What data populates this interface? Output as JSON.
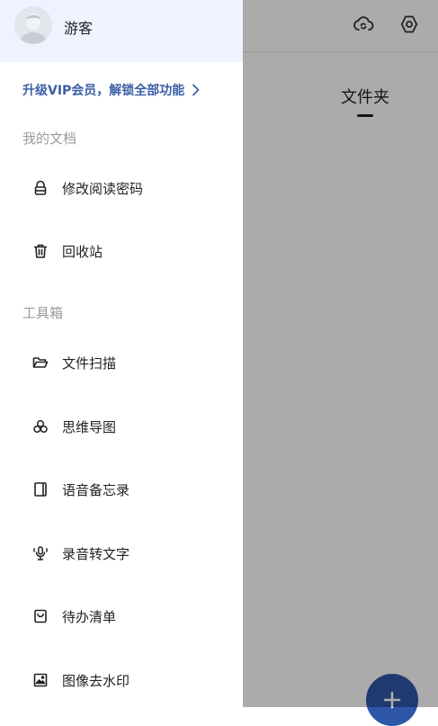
{
  "app": {
    "tab_label": "文件夹"
  },
  "drawer": {
    "username": "游客",
    "vip_text": "升级VIP会员，解锁全部功能",
    "sections": [
      {
        "title": "我的文档"
      },
      {
        "title": "工具箱"
      }
    ],
    "items": [
      {
        "label": "修改阅读密码",
        "icon": "lock-icon"
      },
      {
        "label": "回收站",
        "icon": "trash-icon"
      },
      {
        "label": "文件扫描",
        "icon": "folder-icon"
      },
      {
        "label": "思维导图",
        "icon": "mindmap-icon"
      },
      {
        "label": "语音备忘录",
        "icon": "note-icon"
      },
      {
        "label": "录音转文字",
        "icon": "microphone-icon"
      },
      {
        "label": "待办清单",
        "icon": "todo-icon"
      },
      {
        "label": "图像去水印",
        "icon": "image-icon"
      }
    ]
  },
  "colors": {
    "accent": "#3c5fa6",
    "fab": "#2f57a8",
    "profile_bg": "#eef3ff"
  }
}
